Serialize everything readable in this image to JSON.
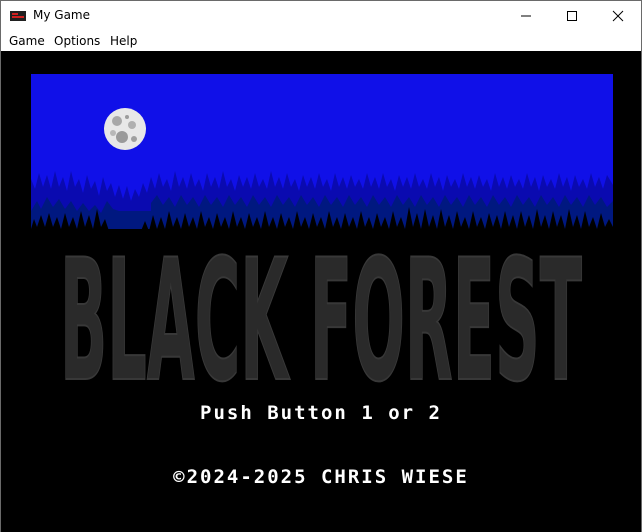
{
  "window": {
    "title": "My Game",
    "icon": "joystick-app-icon",
    "controls": [
      "minimize-icon",
      "maximize-icon",
      "close-icon"
    ]
  },
  "menu": {
    "items": [
      {
        "label": "Game"
      },
      {
        "label": "Options"
      },
      {
        "label": "Help"
      }
    ]
  },
  "game": {
    "title": "BLACK FOREST",
    "prompt": "Push Button 1 or 2",
    "copyright": "©2024-2025 CHRIS WIESE",
    "colors": {
      "sky": "#1010e8",
      "far_trees": "#0a0ab0",
      "mid_trees": "#001880",
      "ground": "#000000",
      "moon": "#e8e8e8",
      "title_fill": "#2a2a2a",
      "text": "#ffffff"
    }
  }
}
